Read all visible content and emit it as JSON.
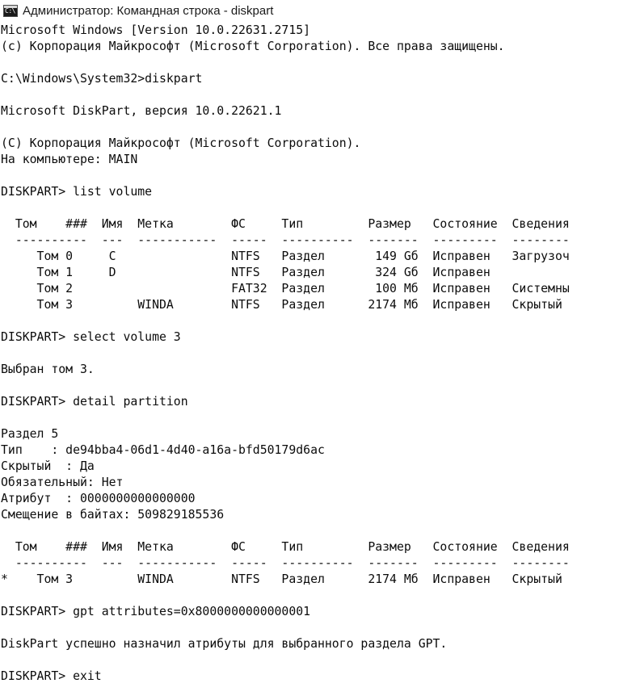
{
  "window": {
    "title": "Администратор: Командная строка - diskpart",
    "icon": "cmd-icon",
    "icon_glyph": "C:\\"
  },
  "console": {
    "lines": [
      "Microsoft Windows [Version 10.0.22631.2715]",
      "(c) Корпорация Майкрософт (Microsoft Corporation). Все права защищены.",
      "",
      "C:\\Windows\\System32>diskpart",
      "",
      "Microsoft DiskPart, версия 10.0.22621.1",
      "",
      "(C) Корпорация Майкрософт (Microsoft Corporation).",
      "На компьютере: MAIN",
      "",
      "DISKPART> list volume",
      "",
      "  Том    ###  Имя  Метка        ФС     Тип         Размер   Состояние  Сведения",
      "  ----------  ---  -----------  -----  ----------  -------  ---------  --------",
      "     Том 0     C                NTFS   Раздел       149 Gб  Исправен   Загрузоч",
      "     Том 1     D                NTFS   Раздел       324 Gб  Исправен",
      "     Том 2                      FAT32  Раздел       100 Мб  Исправен   Системны",
      "     Том 3         WINDA        NTFS   Раздел      2174 Мб  Исправен   Скрытый",
      "",
      "DISKPART> select volume 3",
      "",
      "Выбран том 3.",
      "",
      "DISKPART> detail partition",
      "",
      "Раздел 5",
      "Тип    : de94bba4-06d1-4d40-a16a-bfd50179d6ac",
      "Скрытый  : Да",
      "Обязательный: Нет",
      "Атрибут  : 0000000000000000",
      "Смещение в байтах: 509829185536",
      "",
      "  Том    ###  Имя  Метка        ФС     Тип         Размер   Состояние  Сведения",
      "  ----------  ---  -----------  -----  ----------  -------  ---------  --------",
      "*    Том 3         WINDA        NTFS   Раздел      2174 Мб  Исправен   Скрытый",
      "",
      "DISKPART> gpt attributes=0x8000000000000001",
      "",
      "DiskPart успешно назначил атрибуты для выбранного раздела GPT.",
      "",
      "DISKPART> exit"
    ]
  }
}
